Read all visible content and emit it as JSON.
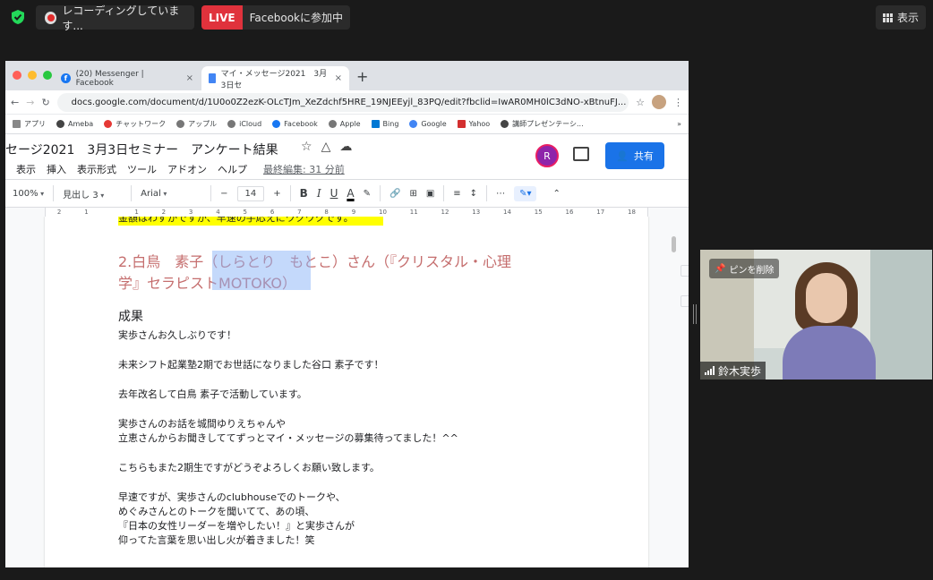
{
  "zoom": {
    "recording_text": "レコーディングしています...",
    "live_badge": "LIVE",
    "live_text": "Facebookに参加中",
    "view_label": "表示"
  },
  "browser": {
    "tabs": [
      {
        "label": "(20) Messenger | Facebook",
        "close": "×"
      },
      {
        "label": "マイ・メッセージ2021　3月3日セ",
        "close": "×"
      }
    ],
    "new_tab": "+",
    "url": "docs.google.com/document/d/1U0o0Z2ezK-OLcTJm_XeZdchf5HRE_19NJEEyjl_83PQ/edit?fbclid=IwAR0MH0lC3dNO-xBtnuFJ...",
    "bookmarks": [
      "アプリ",
      "Ameba",
      "チャットワーク",
      "アップル",
      "iCloud",
      "Facebook",
      "Apple",
      "Bing",
      "Google",
      "Yahoo",
      "講師プレゼンテーシ..."
    ],
    "bookmarks_more": "»"
  },
  "doc": {
    "title": "セージ2021　3月3日セミナー　アンケート結果",
    "menus": [
      "表示",
      "挿入",
      "表示形式",
      "ツール",
      "アドオン",
      "ヘルプ"
    ],
    "last_edit": "最終編集: 31 分前",
    "user_initial": "R",
    "share_label": "共有",
    "toolbar": {
      "zoom": "100%",
      "style": "見出し 3",
      "font": "Arial",
      "minus": "−",
      "size": "14",
      "plus": "+",
      "bold": "B",
      "italic": "I",
      "underline": "U",
      "color": "A",
      "more": "⋯"
    },
    "ruler_ticks": [
      "2",
      "1",
      "",
      "1",
      "2",
      "3",
      "4",
      "5",
      "6",
      "7",
      "8",
      "9",
      "10",
      "11",
      "12",
      "13",
      "14",
      "15",
      "16",
      "17",
      "18"
    ],
    "highlight_text": "金額はわずかですが、早速の手応えにワクワクです。",
    "heading_line1": "2.白鳥　素子（しらとり　もとこ）さん（『クリスタル・心理",
    "heading_line2": "学』セラピストMOTOKO）",
    "section_title": "成果",
    "paragraphs": [
      "実歩さんお久しぶりです！",
      "",
      "未来シフト起業塾2期でお世話になりました谷口 素子です！",
      "",
      "去年改名して白鳥 素子で活動しています。",
      "",
      "実歩さんのお話を城間ゆりえちゃんや",
      "立恵さんからお聞きしててずっとマイ・メッセージの募集待ってました！^^",
      "",
      "こちらもまた2期生ですがどうぞよろしくお願い致します。",
      "",
      "早速ですが、実歩さんのclubhouseでのトークや、",
      "めぐみさんとのトークを聞いてて、あの頃、",
      "『日本の女性リーダーを増やしたい！』と実歩さんが",
      "仰ってた言葉を思い出し火が着きました！笑"
    ]
  },
  "video": {
    "pin_label": "ピンを削除",
    "participant_name": "鈴木実歩"
  }
}
